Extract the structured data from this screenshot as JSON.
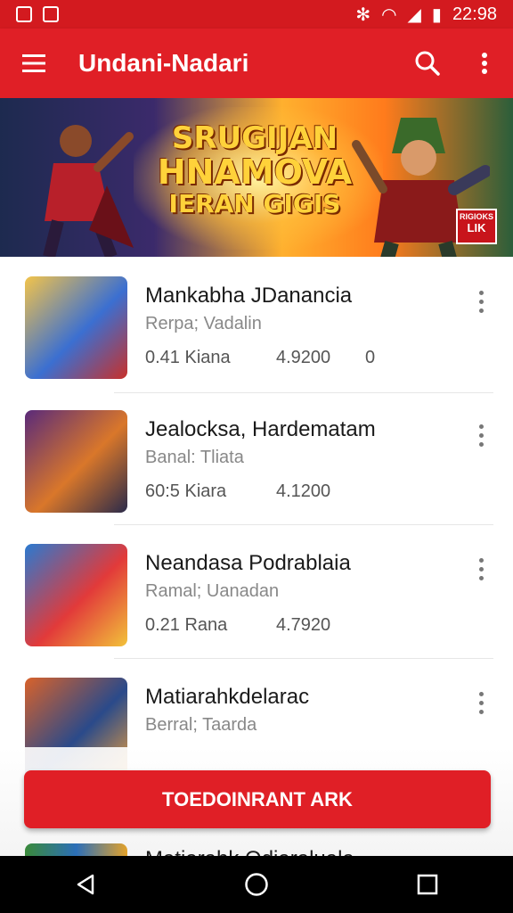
{
  "status_bar": {
    "time": "22:98"
  },
  "app_bar": {
    "title": "Undani-Nadari"
  },
  "banner": {
    "line1": "SRUGIJAN",
    "line2": "HNAMOVA",
    "line3": "IERAN GIGIS",
    "badge_top": "RIGIOKS",
    "badge_bottom": "LIK"
  },
  "games": [
    {
      "title": "Mankabha JDanancia",
      "subtitle": "Rerpa; Vadalin",
      "stat1": "0.41 Kiana",
      "stat2": "4.9200",
      "stat3": "0",
      "colors": [
        "#f3b53a",
        "#3b6fd1",
        "#c33"
      ]
    },
    {
      "title": "Jealocksa, Hardematam",
      "subtitle": "Banal: Tliata",
      "stat1": "60:5 Kiara",
      "stat2": "4.1200",
      "stat3": "",
      "colors": [
        "#5a2a7a",
        "#d9772a",
        "#2a2a4a"
      ]
    },
    {
      "title": "Neandasa Podrablaia",
      "subtitle": "Ramal; Uanadan",
      "stat1": "0.21 Rana",
      "stat2": "4.7920",
      "stat3": "",
      "colors": [
        "#2a7ad1",
        "#e23a3a",
        "#f2c23a"
      ]
    },
    {
      "title": "Matiarahkdelarac",
      "subtitle": "Berral; Taarda",
      "stat1": "",
      "stat2": "",
      "stat3": "",
      "colors": [
        "#d9622a",
        "#2a4a8a",
        "#f2a23a"
      ]
    }
  ],
  "cta": {
    "label": "TOEDOINRANT ARK"
  },
  "peek_row": {
    "title": "Matiarahk Odiaraluala"
  }
}
